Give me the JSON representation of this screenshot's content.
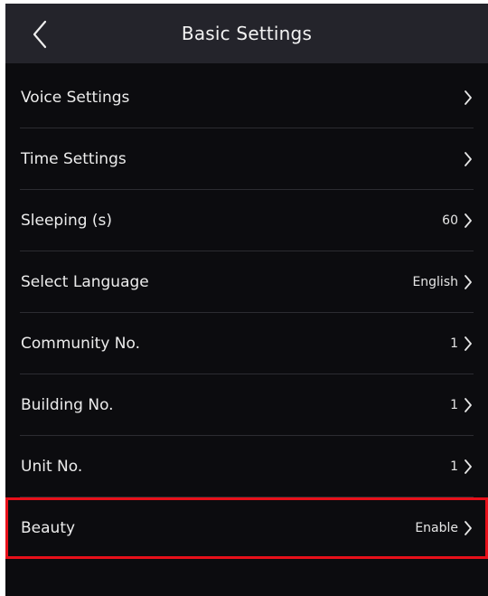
{
  "header": {
    "title": "Basic Settings",
    "back_icon": "chevron-left-icon"
  },
  "settings": {
    "items": [
      {
        "key": "voice-settings",
        "label": "Voice Settings",
        "value": ""
      },
      {
        "key": "time-settings",
        "label": "Time Settings",
        "value": ""
      },
      {
        "key": "sleeping",
        "label": "Sleeping (s)",
        "value": "60"
      },
      {
        "key": "select-language",
        "label": "Select Language",
        "value": "English"
      },
      {
        "key": "community-no",
        "label": "Community No.",
        "value": "1"
      },
      {
        "key": "building-no",
        "label": "Building No.",
        "value": "1"
      },
      {
        "key": "unit-no",
        "label": "Unit No.",
        "value": "1"
      },
      {
        "key": "beauty",
        "label": "Beauty",
        "value": "Enable"
      }
    ],
    "row_icon": "chevron-right-icon"
  },
  "highlight": {
    "item": "beauty",
    "color": "#e8101a"
  },
  "colors": {
    "header_background": "#24242b",
    "screen_background": "#0c0c0f",
    "text": "#ececec",
    "divider": "#2c2c31"
  }
}
